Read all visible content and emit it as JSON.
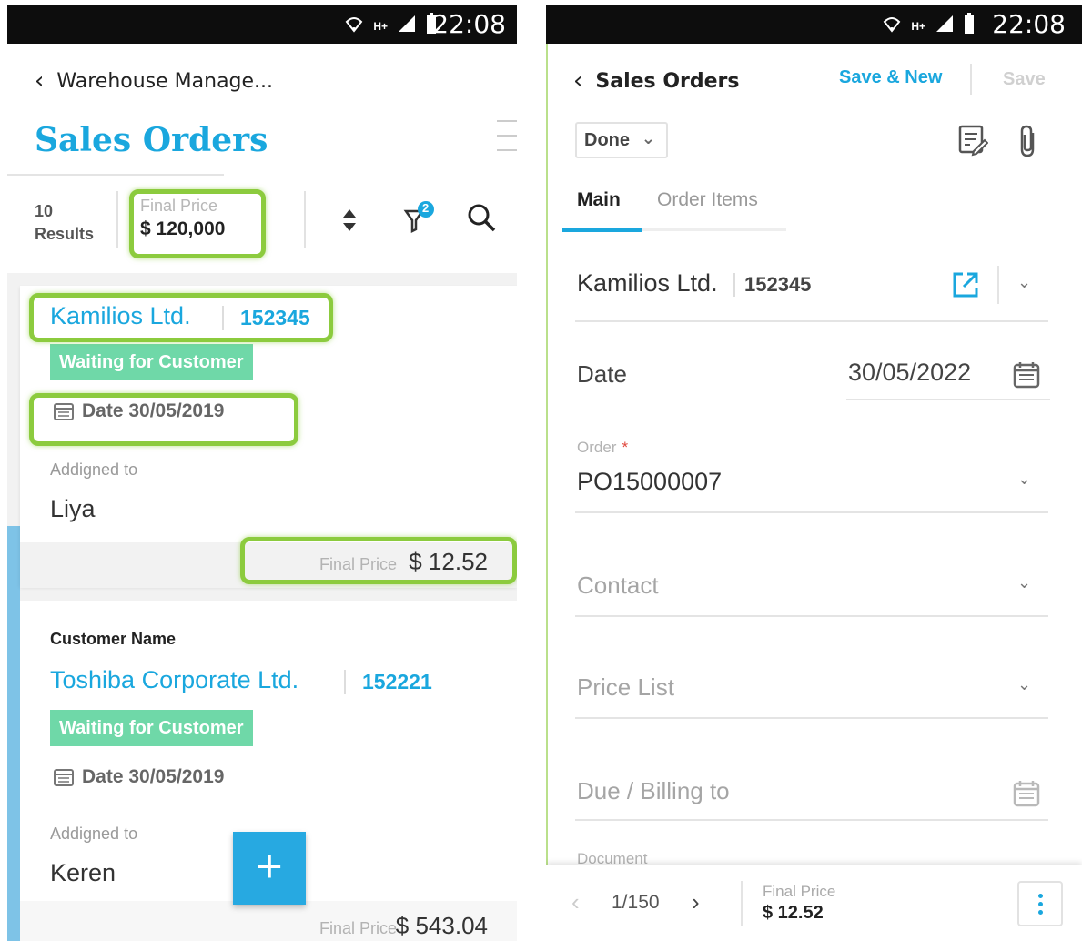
{
  "status_bar": {
    "time_left": "22:08",
    "time_right": "22:08",
    "network": "H+"
  },
  "left": {
    "back_label": "Warehouse Manage...",
    "title": "Sales Orders",
    "toolbar": {
      "results_count": "10",
      "results_label": "Results",
      "final_price_label": "Final Price",
      "final_price_value": "$ 120,000",
      "filter_badge": "2"
    },
    "cards": [
      {
        "customer_name": "Kamilios Ltd.",
        "customer_number": "152345",
        "status": "Waiting for Customer",
        "date": "Date 30/05/2019",
        "assigned_label": "Addigned to",
        "assignee": "Liya",
        "final_price_label": "Final Price",
        "final_price": "$ 12.52"
      },
      {
        "customer_label": "Customer Name",
        "customer_name": "Toshiba Corporate Ltd.",
        "customer_number": "152221",
        "status": "Waiting for Customer",
        "date": "Date 30/05/2019",
        "assigned_label": "Addigned to",
        "assignee": "Keren",
        "final_price_label": "Final Price",
        "final_price": "$ 543.04"
      }
    ],
    "fab_label": "+"
  },
  "right": {
    "back_label": "Sales Orders",
    "save_new": "Save & New",
    "save": "Save",
    "status_button": "Done",
    "tabs": [
      "Main",
      "Order Items"
    ],
    "customer_name": "Kamilios Ltd.",
    "customer_number": "152345",
    "fields": {
      "date_label": "Date",
      "date_value": "30/05/2022",
      "order_label": "Order",
      "order_required": "*",
      "order_value": "PO15000007",
      "contact_label": "Contact",
      "price_list_label": "Price List",
      "due_label": "Due / Billing to",
      "document_label": "Document"
    },
    "bottom_bar": {
      "pagination": "1/150",
      "final_price_label": "Final Price",
      "final_price": "$ 12.52"
    }
  },
  "colors": {
    "accent": "#1aa7de",
    "status": "#6fd8a8",
    "highlight": "#8ccb3e"
  }
}
